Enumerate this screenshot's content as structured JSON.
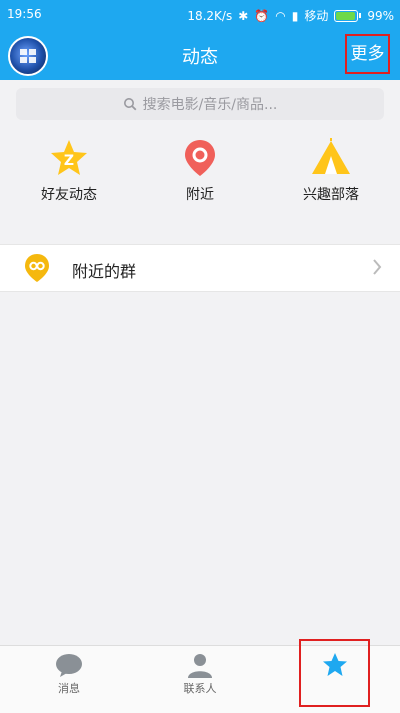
{
  "status_bar": {
    "time": "19:56",
    "speed": "18.2K/s",
    "carrier": "移动",
    "battery": "99%"
  },
  "header": {
    "title": "动态",
    "more_label": "更多"
  },
  "search": {
    "placeholder": "搜索电影/音乐/商品..."
  },
  "quick_actions": [
    {
      "label": "好友动态",
      "icon": "friend-feed-star-icon"
    },
    {
      "label": "附近",
      "icon": "location-pin-icon"
    },
    {
      "label": "兴趣部落",
      "icon": "tent-icon"
    }
  ],
  "groups": {
    "nearby_label": "附近的群"
  },
  "bottom_nav": {
    "items": [
      {
        "label": "消息",
        "icon": "chat-bubble-icon"
      },
      {
        "label": "联系人",
        "icon": "contact-person-icon"
      },
      {
        "label": "",
        "icon": "star-activity-icon"
      }
    ]
  },
  "colors": {
    "accent": "#1ea8f0",
    "highlight_box": "#e02020"
  }
}
